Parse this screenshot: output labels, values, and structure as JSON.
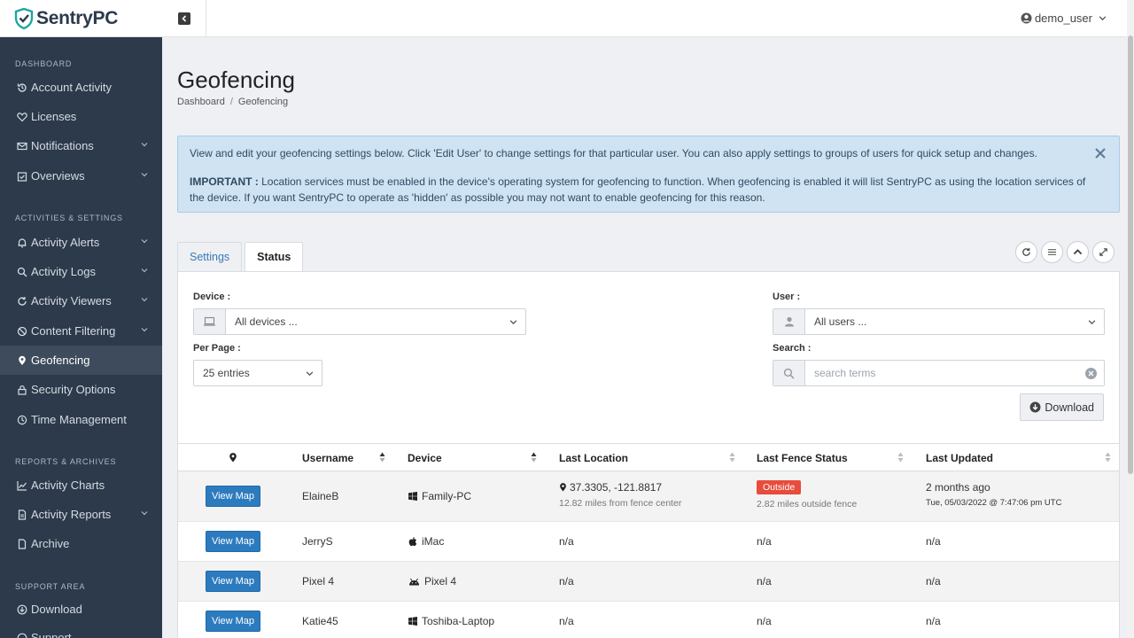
{
  "app": {
    "name": "SentryPC"
  },
  "topbar": {
    "user": "demo_user"
  },
  "sidebar": {
    "sections": [
      "DASHBOARD",
      "ACTIVITIES & SETTINGS",
      "REPORTS & ARCHIVES",
      "SUPPORT AREA"
    ],
    "items": [
      {
        "label": "Account Activity",
        "icon": "history-icon"
      },
      {
        "label": "Licenses",
        "icon": "heart-icon"
      },
      {
        "label": "Notifications",
        "icon": "envelope-icon"
      },
      {
        "label": "Overviews",
        "icon": "calendar-check-icon"
      },
      {
        "label": "Activity Alerts",
        "icon": "bell-icon"
      },
      {
        "label": "Activity Logs",
        "icon": "search-icon"
      },
      {
        "label": "Activity Viewers",
        "icon": "refresh-icon"
      },
      {
        "label": "Content Filtering",
        "icon": "ban-icon"
      },
      {
        "label": "Geofencing",
        "icon": "map-marker-icon"
      },
      {
        "label": "Security Options",
        "icon": "lock-icon"
      },
      {
        "label": "Time Management",
        "icon": "clock-icon"
      },
      {
        "label": "Activity Charts",
        "icon": "chart-icon"
      },
      {
        "label": "Activity Reports",
        "icon": "file-icon"
      },
      {
        "label": "Archive",
        "icon": "archive-icon"
      },
      {
        "label": "Download",
        "icon": "download-icon"
      },
      {
        "label": "Support",
        "icon": "support-icon"
      }
    ]
  },
  "page": {
    "title": "Geofencing",
    "breadcrumb": [
      "Dashboard",
      "Geofencing"
    ]
  },
  "alert": {
    "line1": "View and edit your geofencing settings below.  Click 'Edit User' to change settings for that particular user.  You can also apply settings to groups of users for quick setup and changes.",
    "important_label": "IMPORTANT :",
    "line2": " Location services must be enabled in the device's operating system for geofencing to function.  When geofencing is enabled it will list SentryPC as using the location services of the device.  If you want SentryPC to operate as 'hidden' as possible you may not want to enable geofencing for this reason."
  },
  "tabs": [
    {
      "label": "Settings"
    },
    {
      "label": "Status"
    }
  ],
  "filters": {
    "device_label": "Device :",
    "device_value": "All devices ...",
    "user_label": "User :",
    "user_value": "All users ...",
    "perpage_label": "Per Page :",
    "perpage_value": "25 entries",
    "search_label": "Search :",
    "search_placeholder": "search terms",
    "download_label": "Download"
  },
  "table": {
    "columns": [
      "Username",
      "Device",
      "Last Location",
      "Last Fence Status",
      "Last Updated"
    ],
    "map_button": "View Map",
    "rows": [
      {
        "username": "ElaineB",
        "device": "Family-PC",
        "os": "windows",
        "location": "37.3305, -121.8817",
        "location_sub": "12.82 miles from fence center",
        "status": "Outside",
        "status_sub": "2.82 miles outside fence",
        "updated": "2 months ago",
        "updated_sub": "Tue, 05/03/2022 @ 7:47:06 pm UTC"
      },
      {
        "username": "JerryS",
        "device": "iMac",
        "os": "apple",
        "location": "n/a",
        "status": "n/a",
        "updated": "n/a"
      },
      {
        "username": "Pixel 4",
        "device": "Pixel 4",
        "os": "android",
        "location": "n/a",
        "status": "n/a",
        "updated": "n/a"
      },
      {
        "username": "Katie45",
        "device": "Toshiba-Laptop",
        "os": "windows",
        "location": "n/a",
        "status": "n/a",
        "updated": "n/a"
      }
    ]
  }
}
